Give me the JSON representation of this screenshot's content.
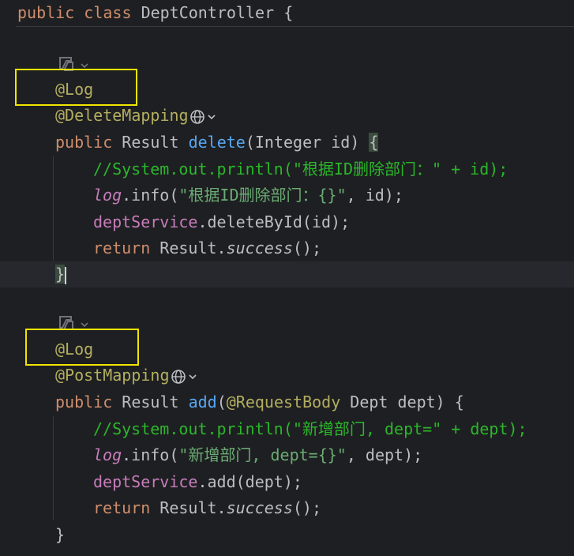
{
  "code": {
    "class_decl": {
      "kw_public": "public",
      "kw_class": "class",
      "name": "DeptController",
      "brace": "{"
    },
    "method1": {
      "annotation_log": "@Log",
      "annotation_mapping": "@DeleteMapping",
      "sig_public": "public",
      "sig_rest_1": " Result ",
      "sig_name": "delete",
      "sig_rest_2": "(Integer id) ",
      "sig_brace": "{",
      "comment": "//System.out.println(\"根据ID删除部门：\" + id);",
      "log_var": "log",
      "log_call": ".info(",
      "log_str": "\"根据ID删除部门：{}\"",
      "log_rest": ", id);",
      "service_var": "deptService",
      "service_call": ".deleteById(id);",
      "return_kw": "return",
      "return_rest_1": " Result.",
      "return_static": "success",
      "return_rest_2": "();",
      "close_brace": "}"
    },
    "method2": {
      "annotation_log": "@Log",
      "annotation_mapping": "@PostMapping",
      "sig_public": "public",
      "sig_rest_1": " Result ",
      "sig_name": "add",
      "sig_paren": "(",
      "sig_ann": "@RequestBody",
      "sig_rest_2": " Dept dept) {",
      "comment": "//System.out.println(\"新增部门, dept=\" + dept);",
      "log_var": "log",
      "log_call": ".info(",
      "log_str": "\"新增部门, dept={}\"",
      "log_rest": ", dept);",
      "service_var": "deptService",
      "service_call": ".add(dept);",
      "return_kw": "return",
      "return_rest_1": " Result.",
      "return_static": "success",
      "return_rest_2": "();",
      "close_brace": "}"
    }
  },
  "icons": {
    "inlay_icon": "ai-assistant-icon",
    "endpoint_icon": "globe-icon",
    "dropdown_icon": "chevron-down-icon"
  },
  "colors": {
    "background": "#1e1f22",
    "highlight_box": "#f0e400",
    "keyword": "#cf8e6d",
    "annotation": "#b3ae60",
    "method": "#56a8f5",
    "comment": "#2bb62b",
    "string": "#6aab73",
    "field": "#c77dbb"
  }
}
